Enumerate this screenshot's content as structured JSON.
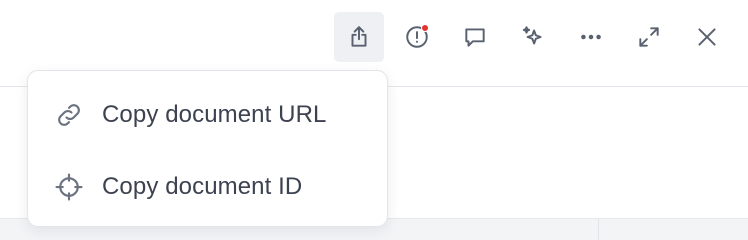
{
  "toolbar": {
    "buttons": [
      {
        "icon": "share-icon",
        "active": true
      },
      {
        "icon": "alert-icon",
        "notification": true
      },
      {
        "icon": "comment-icon"
      },
      {
        "icon": "sparkles-icon"
      },
      {
        "icon": "more-icon"
      },
      {
        "icon": "expand-icon"
      },
      {
        "icon": "close-icon"
      }
    ]
  },
  "menu": {
    "items": [
      {
        "label": "Copy document URL",
        "icon": "link-icon"
      },
      {
        "label": "Copy document ID",
        "icon": "crosshair-icon"
      }
    ]
  },
  "colors": {
    "notification_dot": "#e5342f",
    "active_button_bg": "#eef0f3",
    "icon": "#59606f",
    "text": "#3c4250"
  }
}
